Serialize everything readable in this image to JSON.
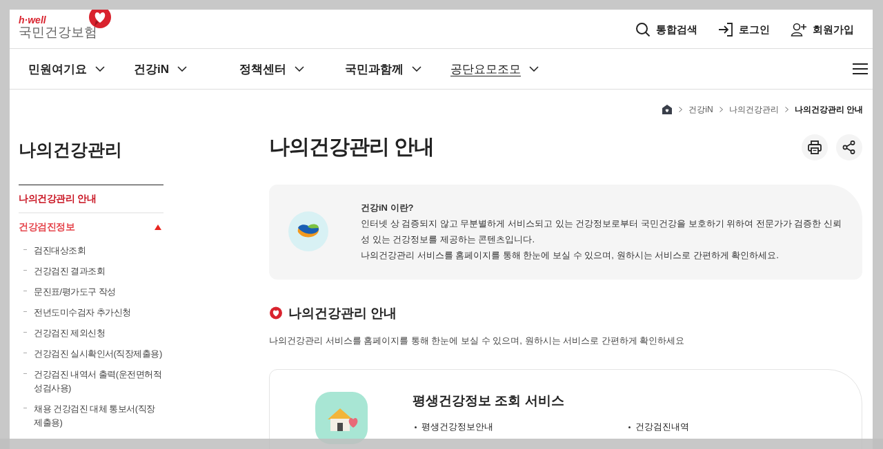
{
  "logo": {
    "tagline": "h·well",
    "name": "국민건강보험"
  },
  "utility_links": [
    {
      "kind": "search",
      "label": "통합검색"
    },
    {
      "kind": "login",
      "label": "로그인"
    },
    {
      "kind": "signup",
      "label": "회원가입"
    }
  ],
  "nav": {
    "items": [
      {
        "label": "민원여기요",
        "selected": false
      },
      {
        "label": "건강iN",
        "selected": false
      },
      {
        "label": "정책센터",
        "selected": false
      },
      {
        "label": "국민과함께",
        "selected": false
      },
      {
        "label": "공단요모조모",
        "selected": true
      }
    ]
  },
  "breadcrumb": [
    "건강iN",
    "나의건강관리",
    "나의건강관리 안내"
  ],
  "sidebar": {
    "title": "나의건강관리",
    "items": [
      {
        "label": "나의건강관리 안내",
        "selected": true
      },
      {
        "label": "건강검진정보",
        "selected": false,
        "expanded": true,
        "children": [
          {
            "label": "검진대상조회",
            "selected": false
          },
          {
            "label": "건강검진 결과조회",
            "selected": false
          },
          {
            "label": "문진표/평가도구 작성",
            "selected": false
          },
          {
            "label": "전년도미수검자 추가신청",
            "selected": false
          },
          {
            "label": "건강검진 제외신청",
            "selected": false
          },
          {
            "label": "건강검진 실시확인서(직장제출용)",
            "selected": false
          },
          {
            "label": "건강검진 내역서 출력(운전면허적성검사용)",
            "selected": false
          },
          {
            "label": "채용 건강검진 대체 통보서(직장제출용)",
            "selected": false
          }
        ]
      }
    ]
  },
  "page": {
    "title": "나의건강관리 안내"
  },
  "info": {
    "title": "건강iN 이란?",
    "paragraphs": [
      "인터넷 상 검증되지 않고 무분별하게 서비스되고 있는 건강정보로부터 국민건강을 보호하기 위하여 전문가가 검증한 신뢰성 있는 건강정보를 제공하는 콘텐츠입니다.",
      "나의건강관리 서비스를 홈페이지를 통해 한눈에 보실 수 있으며, 원하시는 서비스로 간편하게 확인하세요."
    ]
  },
  "section": {
    "title": "나의건강관리 안내",
    "description": "나의건강관리 서비스를 홈페이지를 통해 한눈에 보실 수 있으며, 원하시는 서비스로 간편하게 확인하세요"
  },
  "services": [
    {
      "title": "평생건강정보 조회 서비스",
      "links": [
        "평생건강정보안내",
        "건강검진내역"
      ]
    }
  ]
}
